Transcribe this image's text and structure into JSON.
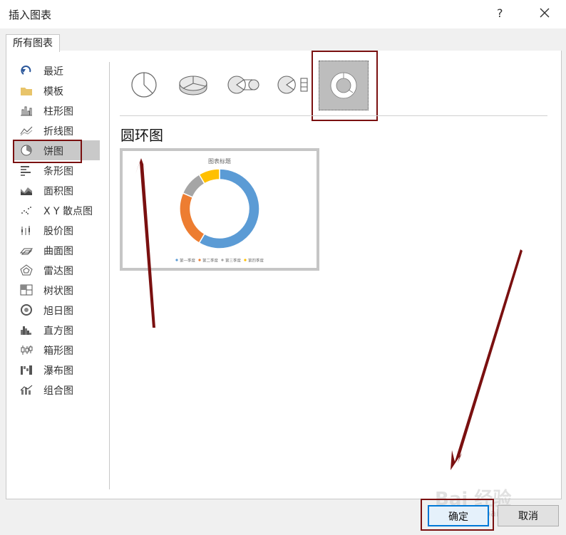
{
  "window": {
    "title": "插入图表",
    "help": "?",
    "close": "×"
  },
  "tab": {
    "label": "所有图表"
  },
  "sidebar": {
    "items": [
      {
        "label": "最近",
        "icon": "undo-icon"
      },
      {
        "label": "模板",
        "icon": "folder-icon"
      },
      {
        "label": "柱形图",
        "icon": "column-chart-icon"
      },
      {
        "label": "折线图",
        "icon": "line-chart-icon"
      },
      {
        "label": "饼图",
        "icon": "pie-chart-icon",
        "selected": true
      },
      {
        "label": "条形图",
        "icon": "bar-chart-icon"
      },
      {
        "label": "面积图",
        "icon": "area-chart-icon"
      },
      {
        "label": "X Y 散点图",
        "icon": "scatter-chart-icon"
      },
      {
        "label": "股价图",
        "icon": "stock-chart-icon"
      },
      {
        "label": "曲面图",
        "icon": "surface-chart-icon"
      },
      {
        "label": "雷达图",
        "icon": "radar-chart-icon"
      },
      {
        "label": "树状图",
        "icon": "treemap-chart-icon"
      },
      {
        "label": "旭日图",
        "icon": "sunburst-chart-icon"
      },
      {
        "label": "直方图",
        "icon": "histogram-chart-icon"
      },
      {
        "label": "箱形图",
        "icon": "box-whisker-chart-icon"
      },
      {
        "label": "瀑布图",
        "icon": "waterfall-chart-icon"
      },
      {
        "label": "组合图",
        "icon": "combo-chart-icon"
      }
    ]
  },
  "subtypes": [
    {
      "icon": "pie-icon"
    },
    {
      "icon": "3d-pie-icon"
    },
    {
      "icon": "pie-of-pie-icon"
    },
    {
      "icon": "bar-of-pie-icon"
    },
    {
      "icon": "doughnut-icon",
      "selected": true
    }
  ],
  "selected_type": {
    "title": "圆环图"
  },
  "preview": {
    "chart_title": "图表标题",
    "legend": [
      "第一季度",
      "第二季度",
      "第三季度",
      "第四季度"
    ],
    "colors": [
      "#5b9bd5",
      "#ed7d31",
      "#a5a5a5",
      "#ffc000"
    ],
    "values": [
      8.2,
      3.2,
      1.4,
      1.2
    ]
  },
  "buttons": {
    "ok": "确定",
    "cancel": "取消"
  },
  "watermark": {
    "text": "Bai 经验",
    "url": "jingyan.baidu.com"
  },
  "colors": {
    "accent": "#0078d7",
    "highlight": "#7a1010",
    "selection": "#c9c9c9"
  }
}
